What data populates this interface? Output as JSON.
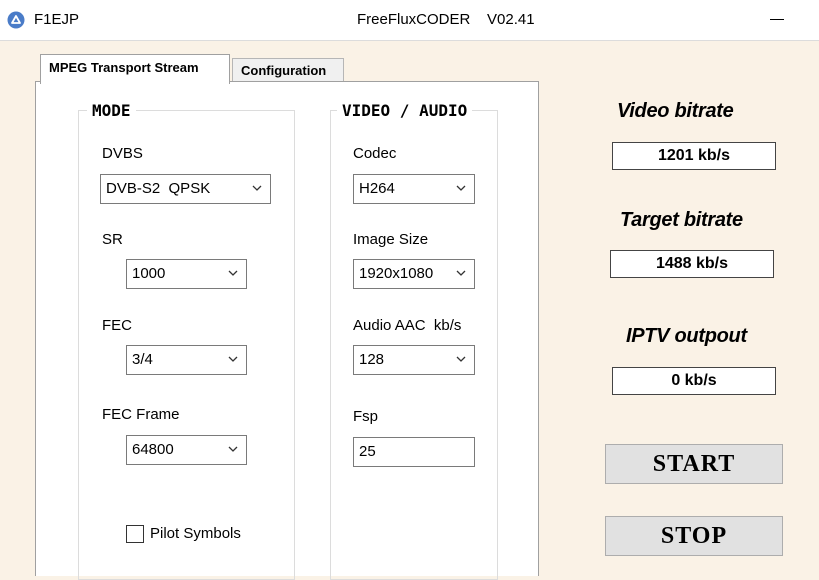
{
  "window": {
    "app_name": "F1EJP",
    "title": "FreeFluxCODER    V02.41"
  },
  "tabs": [
    {
      "label": "MPEG Transport Stream",
      "selected": true
    },
    {
      "label": "Configuration",
      "selected": false
    }
  ],
  "mode": {
    "title": "MODE",
    "dvbs": {
      "label": "DVBS",
      "value": "DVB-S2  QPSK"
    },
    "sr": {
      "label": "SR",
      "value": "1000"
    },
    "fec": {
      "label": "FEC",
      "value": "3/4"
    },
    "fec_frame": {
      "label": "FEC Frame",
      "value": "64800"
    },
    "pilot": {
      "label": "Pilot Symbols",
      "checked": false
    }
  },
  "video_audio": {
    "title": "VIDEO / AUDIO",
    "codec": {
      "label": "Codec",
      "value": "H264"
    },
    "image_size": {
      "label": "Image Size",
      "value": "1920x1080"
    },
    "audio": {
      "label": "Audio AAC  kb/s",
      "value": "128"
    },
    "fsp": {
      "label": "Fsp",
      "value": "25"
    }
  },
  "stats": {
    "video_bitrate": {
      "label": "Video bitrate",
      "value": "1201 kb/s"
    },
    "target_bitrate": {
      "label": "Target bitrate",
      "value": "1488 kb/s"
    },
    "iptv_output": {
      "label": "IPTV outpout",
      "value": "0 kb/s"
    }
  },
  "actions": {
    "start_label": "START",
    "stop_label": "STOP"
  },
  "colors": {
    "background": "#FAF2E6",
    "panel": "#FFFFFF",
    "app_icon": "#4A7CC8"
  }
}
